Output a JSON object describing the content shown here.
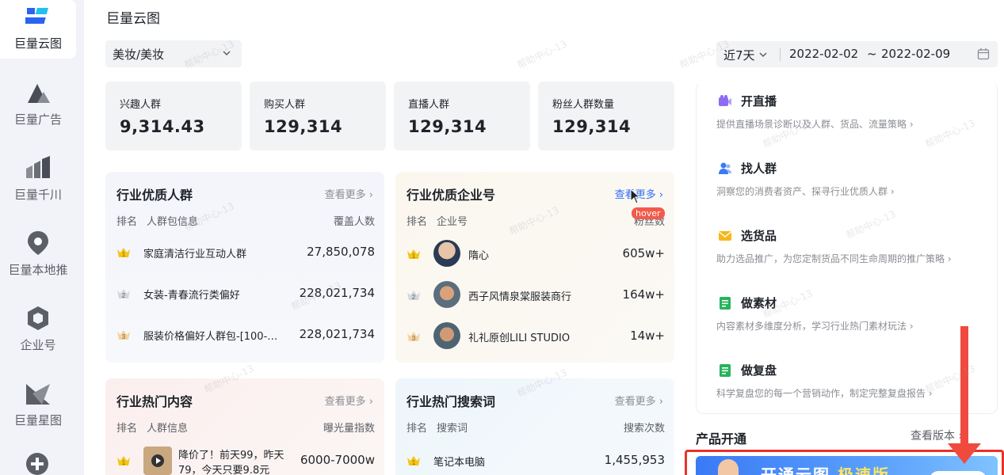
{
  "nav": {
    "items": [
      {
        "label": "巨量云图",
        "icon": "yuntu-logo-icon",
        "active": true
      },
      {
        "label": "巨量广告",
        "icon": "ad-mountain-icon"
      },
      {
        "label": "巨量千川",
        "icon": "qianchuan-bars-icon"
      },
      {
        "label": "巨量本地推",
        "icon": "location-pin-icon"
      },
      {
        "label": "企业号",
        "icon": "hexagon-cube-icon"
      },
      {
        "label": "巨量星图",
        "icon": "star-map-icon"
      }
    ]
  },
  "header": {
    "title": "巨量云图"
  },
  "category_select": {
    "value": "美妆/美妆"
  },
  "date_filter": {
    "range": "近7天",
    "start": "2022-02-02",
    "separator": "~",
    "end": "2022-02-09"
  },
  "stats": [
    {
      "label": "兴趣人群",
      "value": "9,314.43"
    },
    {
      "label": "购买人群",
      "value": "129,314"
    },
    {
      "label": "直播人群",
      "value": "129,314"
    },
    {
      "label": "粉丝人群数量",
      "value": "129,314"
    }
  ],
  "panels": {
    "audience": {
      "title": "行业优质人群",
      "more": "查看更多",
      "cols": [
        "排名",
        "人群包信息",
        "覆盖人数"
      ],
      "rows": [
        {
          "name": "家庭清洁行业互动人群",
          "value": "27,850,078"
        },
        {
          "name": "女装-青春流行类偏好",
          "value": "228,021,734"
        },
        {
          "name": "服装价格偏好人群包-[100-…",
          "value": "228,021,734"
        }
      ]
    },
    "enterprise": {
      "title": "行业优质企业号",
      "more": "查看更多",
      "hover_tag": "hover",
      "cols": [
        "排名",
        "企业号",
        "粉丝数"
      ],
      "rows": [
        {
          "name": "隋心",
          "value": "605w+"
        },
        {
          "name": "西子风情泉棠服装商行",
          "value": "164w+"
        },
        {
          "name": "礼礼原创LILI STUDIO",
          "value": "14w+"
        }
      ]
    },
    "content": {
      "title": "行业热门内容",
      "more": "查看更多",
      "cols": [
        "排名",
        "人群信息",
        "曝光量指数"
      ],
      "rows": [
        {
          "line1": "降价了！前天99，昨天",
          "line2": "79，今天只要9.8元",
          "value": "6000-7000w"
        }
      ]
    },
    "search": {
      "title": "行业热门搜索词",
      "more": "查看更多",
      "cols": [
        "排名",
        "搜索词",
        "搜索次数"
      ],
      "rows": [
        {
          "name": "笔记本电脑",
          "value": "1,455,953"
        }
      ]
    }
  },
  "tools": [
    {
      "title": "开直播",
      "desc": "提供直播场景诊断以及人群、货品、流量策略",
      "icon": "live-camera-icon"
    },
    {
      "title": "找人群",
      "desc": "洞察您的消费者资产、探寻行业优质人群",
      "icon": "people-icon"
    },
    {
      "title": "选货品",
      "desc": "助力选品推广，为您定制货品不同生命周期的推广策略",
      "icon": "envelope-icon"
    },
    {
      "title": "做素材",
      "desc": "内容素材多维度分析，学习行业热门素材玩法",
      "icon": "document-icon"
    },
    {
      "title": "做复盘",
      "desc": "科学复盘您的每一个营销动作，制定完整复盘报告",
      "icon": "report-icon"
    }
  ],
  "products": {
    "title": "产品开通",
    "more": "查看版本",
    "banner_text": "开通云图",
    "banner_highlight": "极速版"
  },
  "watermark": "帮助中心-13",
  "colors": {
    "accent": "#2f6df6",
    "annotation": "#e8322b",
    "gold": "#f5c518"
  }
}
